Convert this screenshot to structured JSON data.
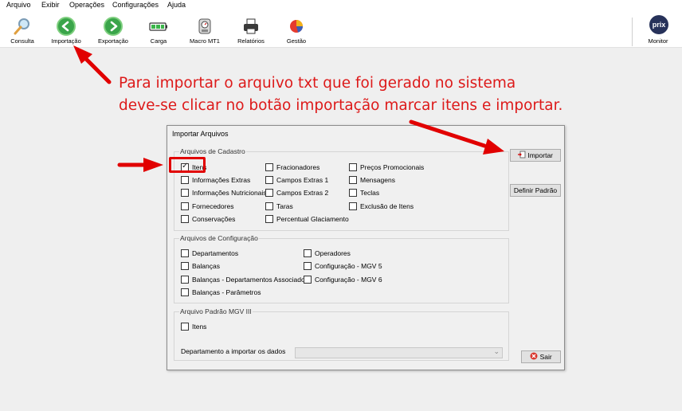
{
  "menu": [
    "Arquivo",
    "Exibir",
    "Operações",
    "Configurações",
    "Ajuda"
  ],
  "toolbar": {
    "buttons": [
      {
        "label": "Consulta",
        "icon": "magnifier-icon"
      },
      {
        "label": "Importação",
        "icon": "import-arrow-icon"
      },
      {
        "label": "Exportação",
        "icon": "export-arrow-icon"
      },
      {
        "label": "Carga",
        "icon": "battery-icon"
      },
      {
        "label": "Macro MT1",
        "icon": "scale-icon"
      },
      {
        "label": "Relatórios",
        "icon": "printer-icon"
      },
      {
        "label": "Gestão",
        "icon": "pie-chart-icon"
      }
    ],
    "monitor": {
      "label": "Monitor",
      "logo": "prix"
    }
  },
  "annotation": {
    "line1": "Para importar o arquivo txt que foi gerado no sistema",
    "line2": "deve-se clicar no botão importação marcar itens e importar."
  },
  "dialog": {
    "title": "Importar Arquivos",
    "cadastro": {
      "label": "Arquivos de Cadastro",
      "col1": [
        "Itens",
        "Informações Extras",
        "Informações Nutricionais",
        "Fornecedores",
        "Conservações"
      ],
      "col2": [
        "Fracionadores",
        "Campos Extras 1",
        "Campos Extras 2",
        "Taras",
        "Percentual Glaciamento"
      ],
      "col3": [
        "Preços Promocionais",
        "Mensagens",
        "Teclas",
        "Exclusão de Itens"
      ]
    },
    "configuracao": {
      "label": "Arquivos de Configuração",
      "col1": [
        "Departamentos",
        "Balanças",
        "Balanças - Departamentos Associados",
        "Balanças - Parâmetros"
      ],
      "col2": [
        "Operadores",
        "Configuração - MGV 5",
        "Configuração - MGV 6"
      ]
    },
    "padrao": {
      "label": "Arquivo Padrão MGV III",
      "item": "Itens",
      "dept_label": "Departamento a importar os dados",
      "dept_value": ""
    },
    "buttons": {
      "importar": "Importar",
      "definir": "Definir Padrão",
      "sair": "Sair"
    },
    "checked": {
      "itens": true
    }
  },
  "colors": {
    "annotation": "#dd1a1a",
    "highlight": "#e10000"
  }
}
